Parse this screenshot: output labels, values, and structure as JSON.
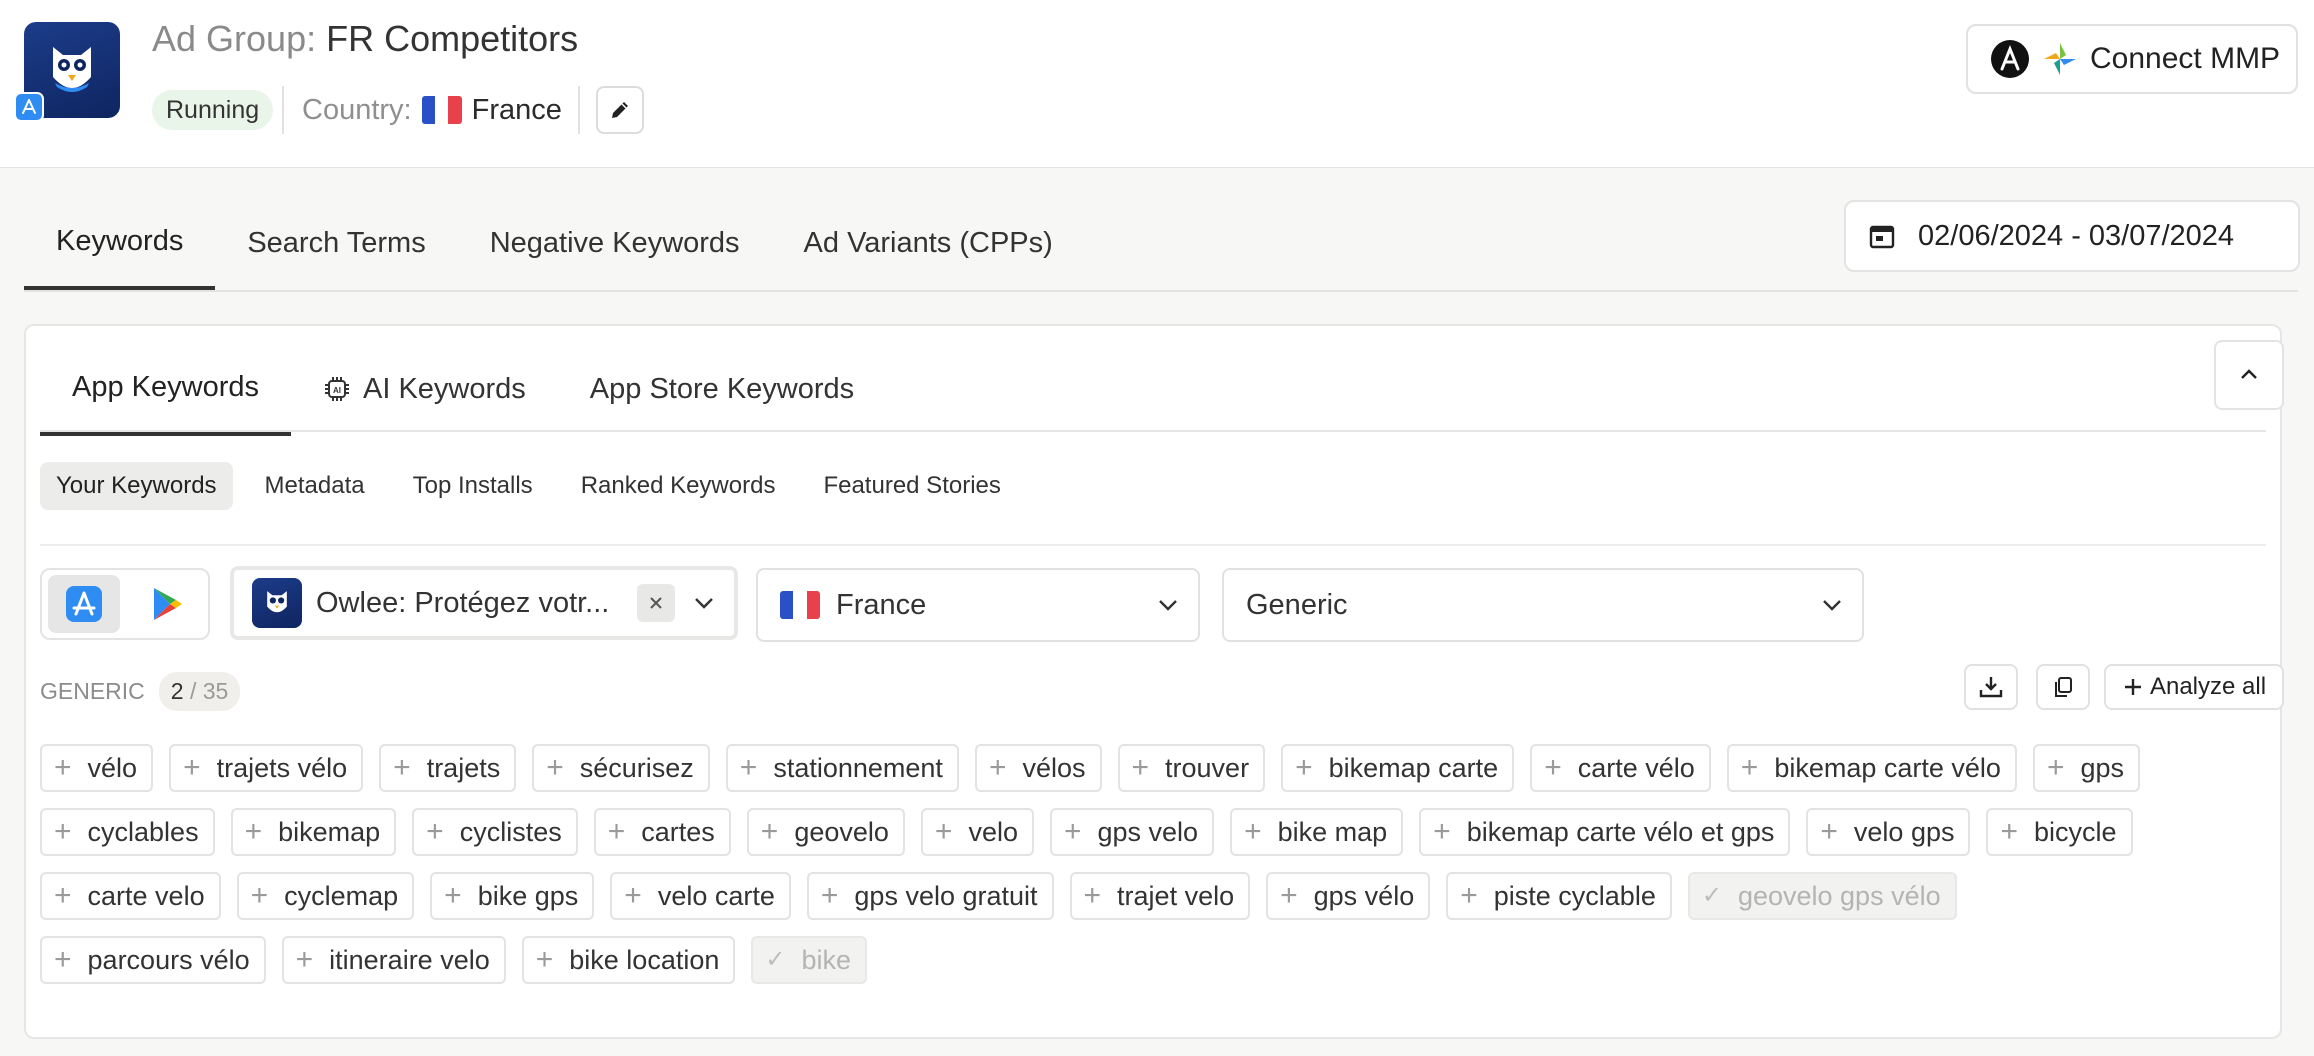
{
  "header": {
    "title_prefix": "Ad Group:",
    "title_name": "FR Competitors",
    "status": "Running",
    "country_label": "Country:",
    "country": "France",
    "connect_mmp": "Connect MMP"
  },
  "main_tabs": [
    {
      "label": "Keywords",
      "active": true
    },
    {
      "label": "Search Terms",
      "active": false
    },
    {
      "label": "Negative Keywords",
      "active": false
    },
    {
      "label": "Ad Variants (CPPs)",
      "active": false
    }
  ],
  "date_range": "02/06/2024 - 03/07/2024",
  "panel": {
    "tabs": [
      {
        "label": "App Keywords",
        "active": true
      },
      {
        "label": "AI Keywords",
        "active": false
      },
      {
        "label": "App Store Keywords",
        "active": false
      }
    ],
    "subtabs": [
      {
        "label": "Your Keywords",
        "active": true
      },
      {
        "label": "Metadata",
        "active": false
      },
      {
        "label": "Top Installs",
        "active": false
      },
      {
        "label": "Ranked Keywords",
        "active": false
      },
      {
        "label": "Featured Stories",
        "active": false
      }
    ],
    "app_select": "Owlee: Protégez votr...",
    "country_select": "France",
    "category_select": "Generic",
    "group_label": "GENERIC",
    "count_selected": "2",
    "count_total": "/ 35",
    "analyze_all": "Analyze all"
  },
  "keywords": [
    [
      {
        "text": "vélo",
        "added": false
      },
      {
        "text": "trajets vélo",
        "added": false
      },
      {
        "text": "trajets",
        "added": false
      },
      {
        "text": "sécurisez",
        "added": false
      },
      {
        "text": "stationnement",
        "added": false
      },
      {
        "text": "vélos",
        "added": false
      },
      {
        "text": "trouver",
        "added": false
      },
      {
        "text": "bikemap carte",
        "added": false
      },
      {
        "text": "carte vélo",
        "added": false
      },
      {
        "text": "bikemap carte vélo",
        "added": false
      },
      {
        "text": "gps",
        "added": false
      }
    ],
    [
      {
        "text": "cyclables",
        "added": false
      },
      {
        "text": "bikemap",
        "added": false
      },
      {
        "text": "cyclistes",
        "added": false
      },
      {
        "text": "cartes",
        "added": false
      },
      {
        "text": "geovelo",
        "added": false
      },
      {
        "text": "velo",
        "added": false
      },
      {
        "text": "gps velo",
        "added": false
      },
      {
        "text": "bike map",
        "added": false
      },
      {
        "text": "bikemap carte vélo et gps",
        "added": false
      },
      {
        "text": "velo gps",
        "added": false
      },
      {
        "text": "bicycle",
        "added": false
      }
    ],
    [
      {
        "text": "carte velo",
        "added": false
      },
      {
        "text": "cyclemap",
        "added": false
      },
      {
        "text": "bike gps",
        "added": false
      },
      {
        "text": "velo carte",
        "added": false
      },
      {
        "text": "gps velo gratuit",
        "added": false
      },
      {
        "text": "trajet velo",
        "added": false
      },
      {
        "text": "gps vélo",
        "added": false
      },
      {
        "text": "piste cyclable",
        "added": false
      },
      {
        "text": "geovelo gps vélo",
        "added": true
      }
    ],
    [
      {
        "text": "parcours vélo",
        "added": false
      },
      {
        "text": "itineraire velo",
        "added": false
      },
      {
        "text": "bike location",
        "added": false
      },
      {
        "text": "bike",
        "added": true
      }
    ]
  ]
}
